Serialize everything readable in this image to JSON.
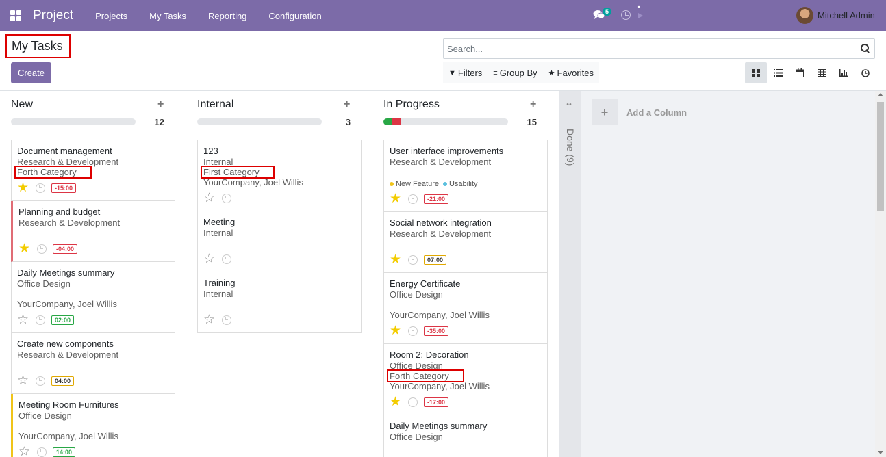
{
  "navbar": {
    "app_name": "Project",
    "menu": [
      "Projects",
      "My Tasks",
      "Reporting",
      "Configuration"
    ],
    "chat_count": "5",
    "user_name": "Mitchell Admin",
    "bg_color": "#7c6ba8"
  },
  "control": {
    "breadcrumb": "My Tasks",
    "create_label": "Create",
    "search_placeholder": "Search...",
    "filters_label": "Filters",
    "group_by_label": "Group By",
    "favorites_label": "Favorites",
    "views": [
      "kanban-icon",
      "list-icon",
      "calendar-icon",
      "pivot-icon",
      "graph-icon",
      "activity-icon"
    ]
  },
  "columns": [
    {
      "title": "New",
      "count": "12",
      "progress": {
        "green": 0,
        "red": 0
      },
      "cards": [
        {
          "title": "Document management",
          "sub": "Research & Development",
          "extra": "Forth Category",
          "extra_highlight": true,
          "line": "",
          "starred": true,
          "badge": "-15:00",
          "badge_color": "red",
          "priority": ""
        },
        {
          "title": "Planning and budget",
          "sub": "Research & Development",
          "extra": "",
          "line": "",
          "starred": true,
          "badge": "-04:00",
          "badge_color": "red",
          "priority": "red"
        },
        {
          "title": "Daily Meetings summary",
          "sub": "Office Design",
          "extra": "",
          "line": "YourCompany, Joel Willis",
          "starred": false,
          "badge": "02:00",
          "badge_color": "green",
          "priority": ""
        },
        {
          "title": "Create new components",
          "sub": "Research & Development",
          "extra": "",
          "line": "",
          "starred": false,
          "badge": "04:00",
          "badge_color": "yellow",
          "priority": ""
        },
        {
          "title": "Meeting Room Furnitures",
          "sub": "Office Design",
          "extra": "",
          "line": "YourCompany, Joel Willis",
          "starred": false,
          "badge": "14:00",
          "badge_color": "green",
          "priority": "yellow"
        }
      ]
    },
    {
      "title": "Internal",
      "count": "3",
      "progress": {
        "green": 0,
        "red": 0
      },
      "cards": [
        {
          "title": "123",
          "sub": "Internal",
          "extra": "First Category",
          "extra_highlight": true,
          "line": "YourCompany, Joel Willis",
          "starred": false,
          "badge": "",
          "badge_color": "",
          "priority": ""
        },
        {
          "title": "Meeting",
          "sub": "Internal",
          "extra": "",
          "line": "",
          "starred": false,
          "badge": "",
          "badge_color": "",
          "priority": ""
        },
        {
          "title": "Training",
          "sub": "Internal",
          "extra": "",
          "line": "",
          "starred": false,
          "badge": "",
          "badge_color": "",
          "priority": ""
        }
      ]
    },
    {
      "title": "In Progress",
      "count": "15",
      "progress": {
        "green": 0.07,
        "red": 0.07
      },
      "cards": [
        {
          "title": "User interface improvements",
          "sub": "Research & Development",
          "extra": "",
          "line": "",
          "tags": [
            {
              "name": "New Feature",
              "color": "#f0c419"
            },
            {
              "name": "Usability",
              "color": "#5bc0de"
            }
          ],
          "starred": true,
          "badge": "-21:00",
          "badge_color": "red",
          "priority": ""
        },
        {
          "title": "Social network integration",
          "sub": "Research & Development",
          "extra": "",
          "line": "",
          "starred": true,
          "badge": "07:00",
          "badge_color": "yellow",
          "priority": ""
        },
        {
          "title": "Energy Certificate",
          "sub": "Office Design",
          "extra": "",
          "line": "YourCompany, Joel Willis",
          "starred": true,
          "badge": "-35:00",
          "badge_color": "red",
          "priority": ""
        },
        {
          "title": "Room 2: Decoration",
          "sub": "Office Design",
          "extra": "Forth Category",
          "extra_highlight": true,
          "line": "YourCompany, Joel Willis",
          "starred": true,
          "badge": "-17:00",
          "badge_color": "red",
          "priority": ""
        },
        {
          "title": "Daily Meetings summary",
          "sub": "Office Design",
          "extra": "",
          "line": "",
          "starred": false,
          "badge": "",
          "badge_color": "",
          "priority": ""
        }
      ]
    }
  ],
  "folded_column": "Done (9)",
  "add_column_label": "Add a Column"
}
